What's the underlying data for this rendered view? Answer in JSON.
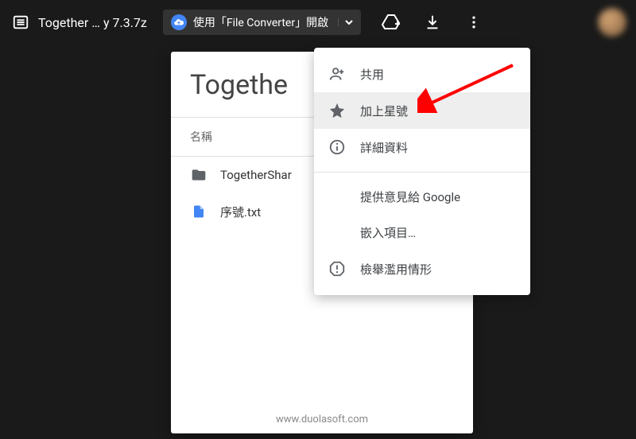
{
  "topbar": {
    "title": "Together … y 7.3.7z",
    "chip_label": "使用「File Converter」開啟"
  },
  "card": {
    "title": "Togethe",
    "header": "名稱",
    "rows": [
      {
        "kind": "folder",
        "label": "TogetherShar"
      },
      {
        "kind": "file",
        "label": "序號.txt"
      }
    ],
    "footer": "www.duolasoft.com"
  },
  "menu": {
    "items": [
      {
        "icon": "person-add-icon",
        "label": "共用"
      },
      {
        "icon": "star-icon",
        "label": "加上星號",
        "hover": true
      },
      {
        "icon": "info-icon",
        "label": "詳細資料"
      }
    ],
    "items2": [
      {
        "label": "提供意見給 Google"
      },
      {
        "label": "嵌入項目…"
      },
      {
        "icon": "report-icon",
        "label": "檢舉濫用情形"
      }
    ]
  }
}
